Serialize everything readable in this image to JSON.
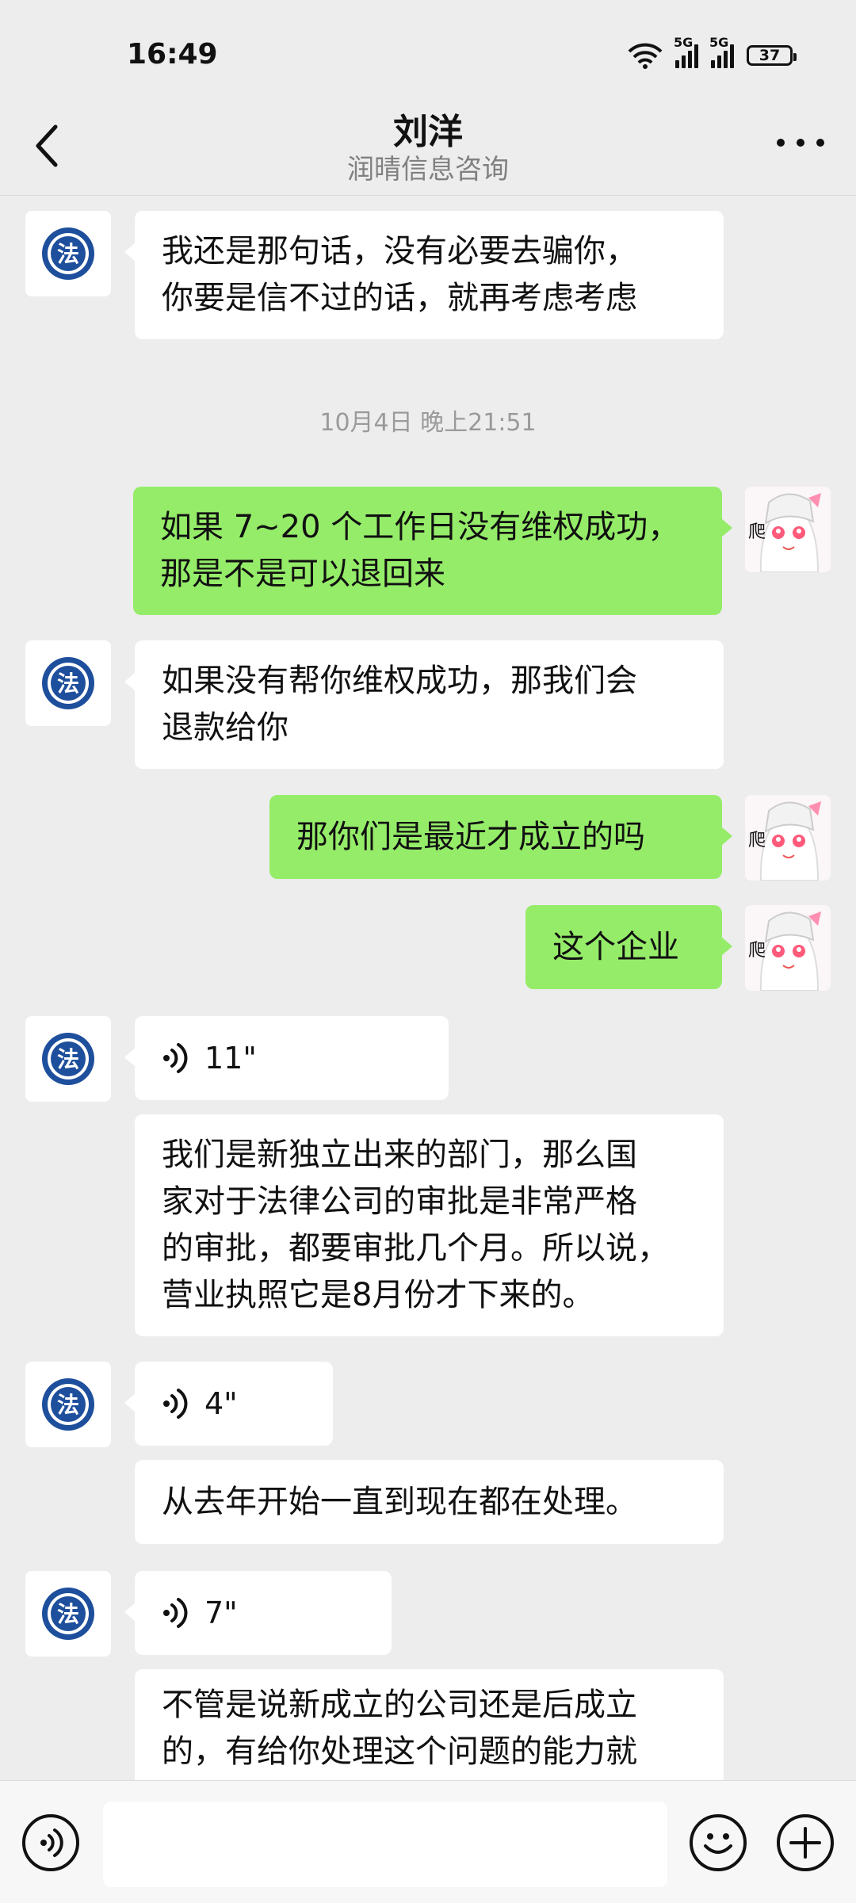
{
  "status_bar": {
    "time": "16:49",
    "sim1_label": "5G",
    "sim2_label": "5G",
    "battery": "37",
    "icons": [
      "wifi-icon",
      "signal-icon",
      "signal-icon",
      "battery-icon"
    ]
  },
  "header": {
    "title": "刘洋",
    "subtitle": "润晴信息咨询",
    "back_icon": "chevron-left-icon",
    "more_icon": "more-dots-icon"
  },
  "timestamp": "10月4日 晚上21:51",
  "messages": [
    {
      "from": "them",
      "type": "text",
      "text": "我还是那句话，没有必要去骗你，\n你要是信不过的话，就再考虑考虑"
    },
    {
      "from": "me",
      "type": "text",
      "text": "如果 7~20 个工作日没有维权成功，\n那是不是可以退回来"
    },
    {
      "from": "them",
      "type": "text",
      "text": "如果没有帮你维权成功，那我们会\n退款给你"
    },
    {
      "from": "me",
      "type": "text",
      "text": "那你们是最近才成立的吗"
    },
    {
      "from": "me",
      "type": "text",
      "text": "这个企业"
    },
    {
      "from": "them",
      "type": "voice",
      "duration": "11\""
    },
    {
      "from": "them",
      "type": "transcript",
      "text": "我们是新独立出来的部门，那么国\n家对于法律公司的审批是非常严格\n的审批，都要审批几个月。所以说，\n营业执照它是8月份才下来的。"
    },
    {
      "from": "them",
      "type": "voice",
      "duration": "4\""
    },
    {
      "from": "them",
      "type": "transcript",
      "text": "从去年开始一直到现在都在处理。"
    },
    {
      "from": "them",
      "type": "voice",
      "duration": "7\""
    },
    {
      "from": "them",
      "type": "transcript",
      "text": "不管是说新成立的公司还是后成立\n的，有给你处理这个问题的能力就"
    }
  ],
  "avatars": {
    "them_logo_text": "法",
    "me_avatar_text": "爬"
  },
  "input_bar": {
    "value": "",
    "icons": [
      "voice-input-icon",
      "emoji-icon",
      "plus-icon"
    ]
  }
}
